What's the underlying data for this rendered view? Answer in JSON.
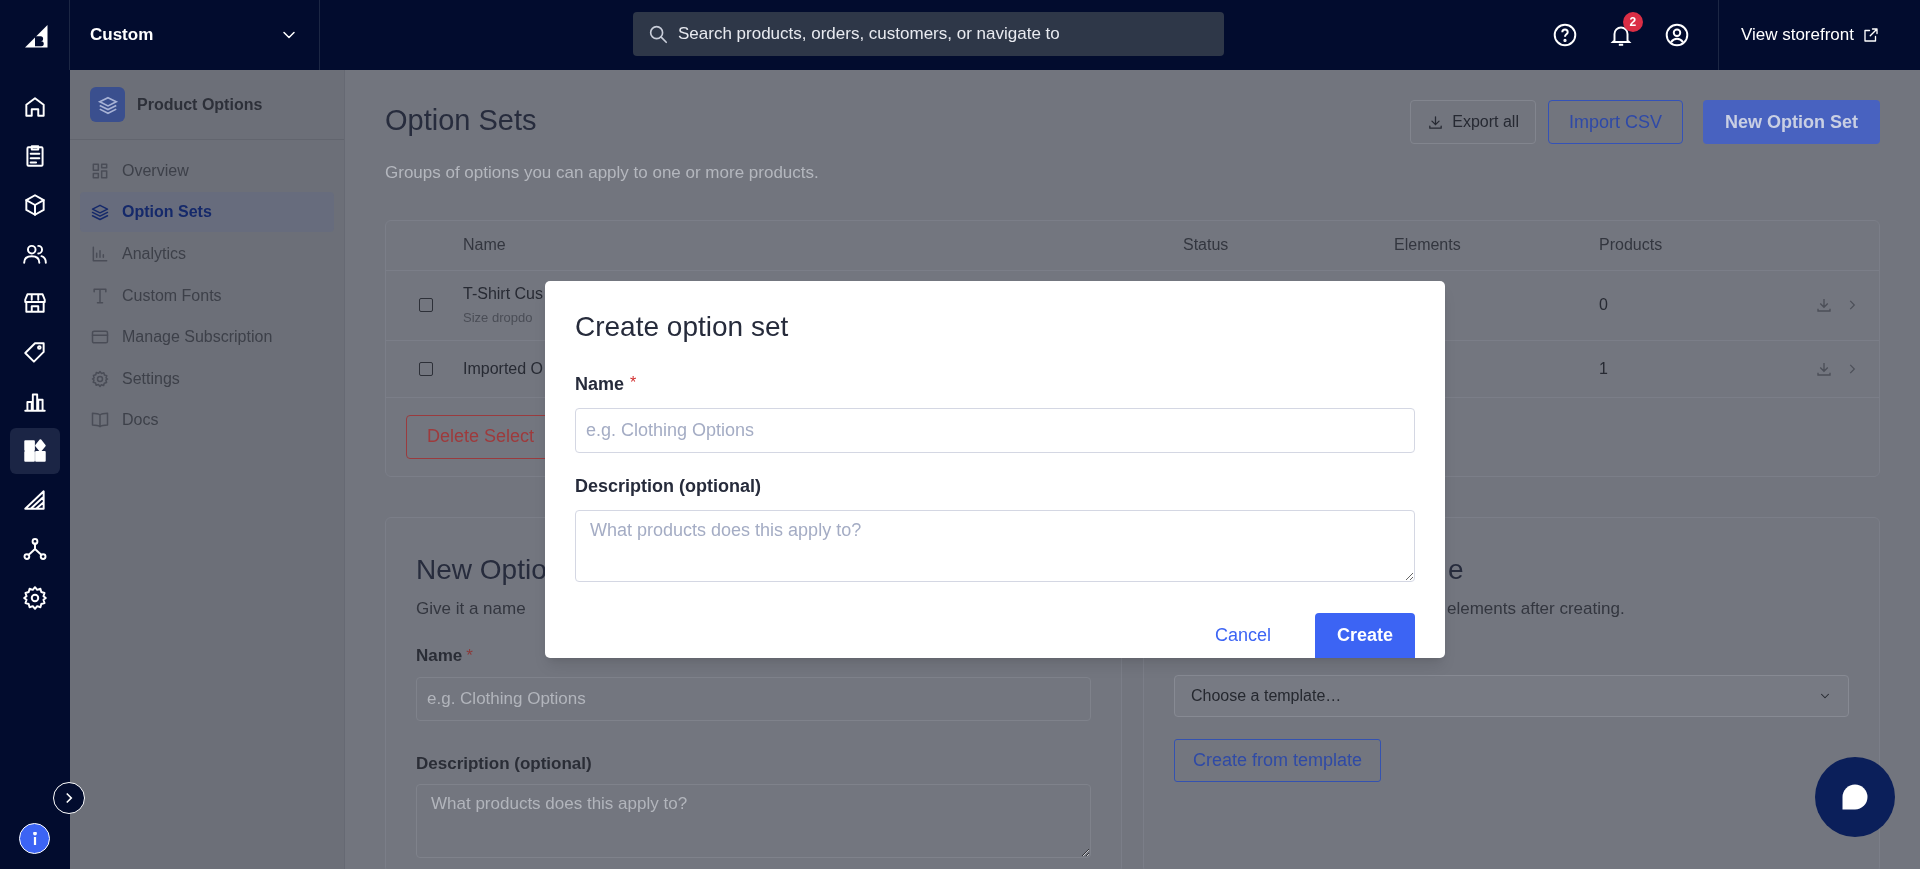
{
  "top_bar": {
    "store_name": "Custom",
    "search": {
      "placeholder": "Search products, orders, customers, or navigate to"
    },
    "notification_count": "2",
    "storefront_link": "View storefront"
  },
  "rail": [
    {
      "kind": "home",
      "selected": false
    },
    {
      "kind": "orders",
      "selected": false
    },
    {
      "kind": "products",
      "selected": false
    },
    {
      "kind": "customers",
      "selected": false
    },
    {
      "kind": "storefront",
      "selected": false
    },
    {
      "kind": "marketing",
      "selected": false
    },
    {
      "kind": "analytics",
      "selected": false
    },
    {
      "kind": "apps",
      "selected": true
    },
    {
      "kind": "channels",
      "selected": false
    },
    {
      "kind": "partners",
      "selected": false
    },
    {
      "kind": "settings",
      "selected": false
    }
  ],
  "app_sidebar": {
    "title": "Product Options",
    "items": [
      {
        "label": "Overview",
        "kind": "grid",
        "selected": false
      },
      {
        "label": "Option Sets",
        "kind": "layers",
        "selected": true
      },
      {
        "label": "Analytics",
        "kind": "bars",
        "selected": false
      },
      {
        "label": "Custom Fonts",
        "kind": "type",
        "selected": false
      },
      {
        "label": "Manage Subscription",
        "kind": "card",
        "selected": false
      },
      {
        "label": "Settings",
        "kind": "gear",
        "selected": false
      },
      {
        "label": "Docs",
        "kind": "book",
        "selected": false
      }
    ]
  },
  "page": {
    "title": "Option Sets",
    "subtitle": "Groups of options you can apply to one or more products.",
    "actions": [
      {
        "label": "Export all",
        "kind": "outline"
      },
      {
        "label": "Import CSV",
        "kind": "outline-blue"
      },
      {
        "label": "New Option Set",
        "kind": "primary"
      }
    ]
  },
  "table": {
    "columns": [
      "Name",
      "Status",
      "Elements",
      "Products"
    ],
    "rows": [
      {
        "checked": false,
        "name": "T-Shirt Cus",
        "description": "Size dropdo",
        "products": "0"
      },
      {
        "checked": false,
        "name": "Imported O",
        "products": "1"
      }
    ],
    "footer_button": "Delete Select"
  },
  "new_panel": {
    "title": "New Optio",
    "subtitle": "Give it a name",
    "name_label": "Name",
    "required_mark": "*",
    "name_placeholder": "e.g. Clothing Options",
    "description_label": "Description (optional)",
    "description_placeholder": "What products does this apply to?"
  },
  "template_panel": {
    "title": "e",
    "subtitle": "elements after creating.",
    "select_value": "Choose a template…",
    "button": "Create from template"
  },
  "modal": {
    "title": "Create option set",
    "fields": [
      {
        "kind": "input",
        "label": "Name",
        "required_mark": "*",
        "placeholder": "e.g. Clothing Options"
      },
      {
        "kind": "textarea",
        "label": "Description (optional)",
        "placeholder": "What products does this apply to?"
      }
    ],
    "cancel": "Cancel",
    "submit": "Create"
  }
}
